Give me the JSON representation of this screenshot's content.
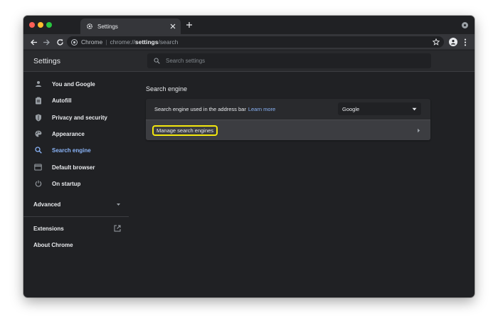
{
  "tab": {
    "title": "Settings"
  },
  "omnibox": {
    "chip": "Chrome",
    "separator": "|",
    "url_scheme": "chrome://",
    "url_host": "settings",
    "url_path": "/search"
  },
  "header": {
    "title": "Settings",
    "search_placeholder": "Search settings"
  },
  "sidebar": {
    "items": [
      {
        "label": "You and Google",
        "icon": "person-icon"
      },
      {
        "label": "Autofill",
        "icon": "clipboard-icon"
      },
      {
        "label": "Privacy and security",
        "icon": "shield-icon"
      },
      {
        "label": "Appearance",
        "icon": "palette-icon"
      },
      {
        "label": "Search engine",
        "icon": "search-icon",
        "active": true
      },
      {
        "label": "Default browser",
        "icon": "browser-window-icon"
      },
      {
        "label": "On startup",
        "icon": "power-icon"
      }
    ],
    "advanced_label": "Advanced",
    "extensions_label": "Extensions",
    "about_label": "About Chrome"
  },
  "main": {
    "section_title": "Search engine",
    "address_bar_label": "Search engine used in the address bar",
    "learn_more": "Learn more",
    "engine_value": "Google",
    "manage_label": "Manage search engines"
  },
  "colors": {
    "background": "#202124",
    "surface": "#292a2d",
    "accent": "#8ab4f8",
    "highlight": "#f4e80e"
  }
}
